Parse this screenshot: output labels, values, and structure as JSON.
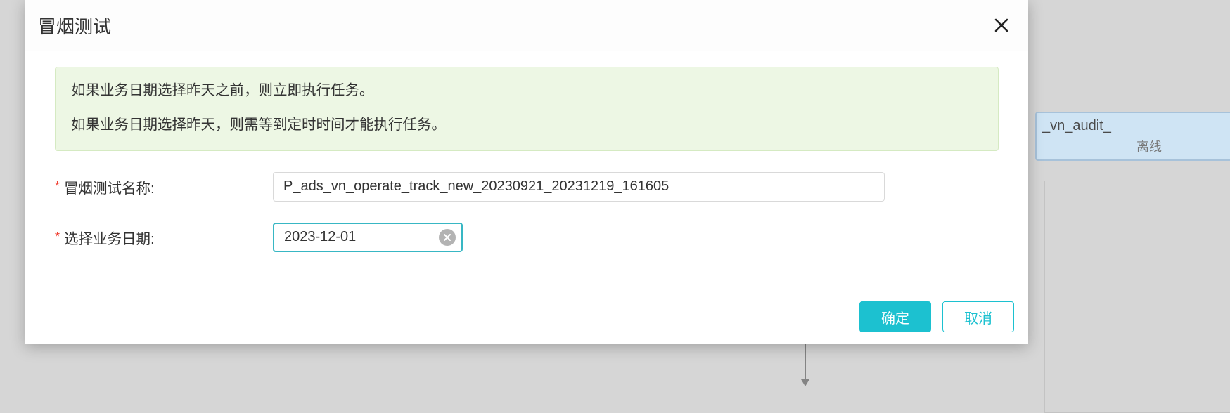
{
  "modal": {
    "title": "冒烟测试",
    "alert": {
      "line1": "如果业务日期选择昨天之前，则立即执行任务。",
      "line2": "如果业务日期选择昨天，则需等到定时时间才能执行任务。"
    },
    "fields": {
      "name": {
        "label": "冒烟测试名称:",
        "value": "P_ads_vn_operate_track_new_20230921_20231219_161605"
      },
      "bizDate": {
        "label": "选择业务日期:",
        "value": "2023-12-01"
      }
    },
    "buttons": {
      "ok": "确定",
      "cancel": "取消"
    }
  },
  "background": {
    "node_title_fragment": "_vn_audit_",
    "node_sub_fragment": "离线"
  }
}
